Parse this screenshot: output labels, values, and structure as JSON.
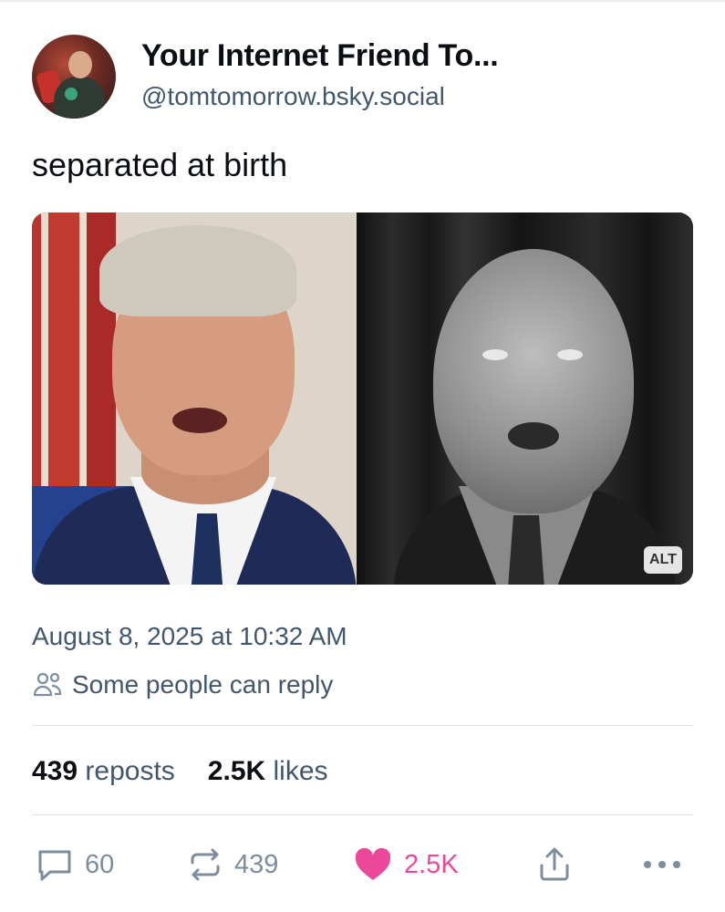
{
  "post": {
    "author": {
      "display_name": "Your Internet Friend To...",
      "handle": "@tomtomorrow.bsky.social"
    },
    "text": "separated at birth",
    "media": {
      "alt_badge": "ALT"
    },
    "timestamp": "August 8, 2025 at 10:32 AM",
    "reply_setting": "Some people can reply",
    "stats": {
      "reposts_count": "439",
      "reposts_label": "reposts",
      "likes_count": "2.5K",
      "likes_label": "likes"
    },
    "actions": {
      "reply_count": "60",
      "repost_count": "439",
      "like_count": "2.5K"
    }
  },
  "icons": {
    "reply": "speech-bubble-icon",
    "repost": "repost-arrows-icon",
    "like": "heart-icon",
    "share": "share-icon",
    "more": "ellipsis-icon",
    "reply_setting": "people-icon"
  },
  "colors": {
    "like_active": "#ec4899",
    "muted_text": "#42576c",
    "action_gray": "#7d8d9d"
  }
}
